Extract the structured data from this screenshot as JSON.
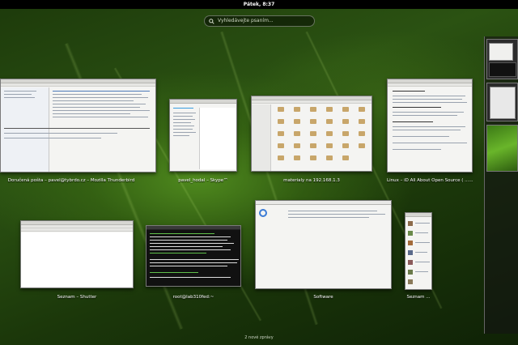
{
  "topbar": {
    "clock": "Pátek, 8:37"
  },
  "search": {
    "placeholder": "Vyhledávejte psaním..."
  },
  "windows": {
    "thunderbird": {
      "caption": "Doručená pošta – pavel@tybrdo.cz – Mozilla Thunderbird"
    },
    "skype": {
      "caption": "pavel_hodal – Skype™"
    },
    "files": {
      "caption": "materialy na 192.168.1.3"
    },
    "browser": {
      "caption": "Linux – iD All About Open Source ( ...... F..."
    },
    "shutter": {
      "caption": "Seznam – Shutter"
    },
    "terminal": {
      "caption": "root@lab310fed:~"
    },
    "software": {
      "caption": "Software"
    },
    "seznam": {
      "caption": "Seznam ..."
    }
  },
  "workspaces_count": 3,
  "notifications": {
    "message": "2 nové zprávy"
  },
  "colors": {
    "topbar": "#000000",
    "wallpaper_green": "#2b5212",
    "terminal_text": "#5fbf4a"
  }
}
